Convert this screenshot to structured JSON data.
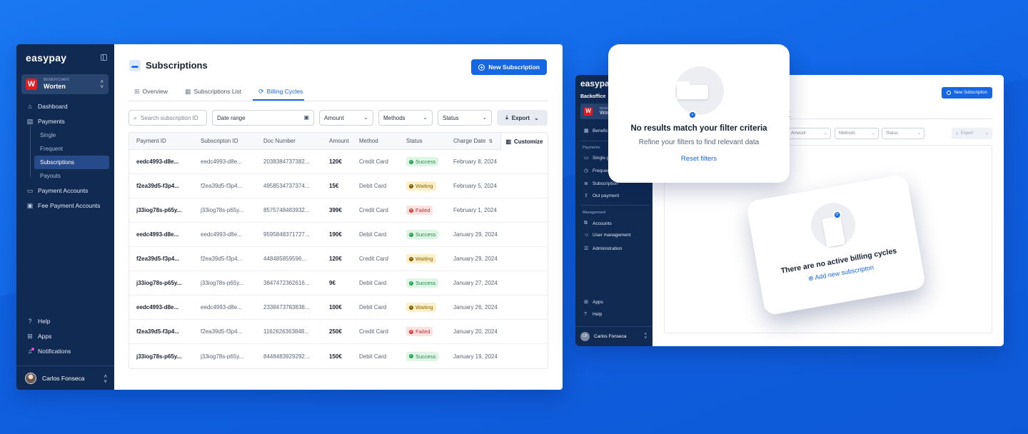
{
  "main_window": {
    "sidebar": {
      "logo": "easypay",
      "beneficiary": {
        "tag": "BENEFICIARY",
        "name": "Worten",
        "logo_letter": "W"
      },
      "nav": [
        {
          "label": "Dashboard"
        },
        {
          "label": "Payments"
        },
        {
          "label": "Single"
        },
        {
          "label": "Frequent"
        },
        {
          "label": "Subscriptions"
        },
        {
          "label": "Payouts"
        },
        {
          "label": "Payment Accounts"
        },
        {
          "label": "Fee Payment Accounts"
        }
      ],
      "bottom": [
        {
          "label": "Help"
        },
        {
          "label": "Apps"
        },
        {
          "label": "Notifications"
        }
      ],
      "user": "Carlos Fonseca"
    },
    "header": {
      "title": "Subscriptions",
      "new_button": "New Subscription"
    },
    "tabs": [
      {
        "label": "Overview"
      },
      {
        "label": "Subscriptions List"
      },
      {
        "label": "Billing Cycles"
      }
    ],
    "filters": {
      "search_placeholder": "Search subscription ID",
      "date_range": "Date range",
      "amount": "Amount",
      "methods": "Methods",
      "status": "Status",
      "export": "Export"
    },
    "table": {
      "columns": [
        "Payment ID",
        "Subscripton ID",
        "Doc Number",
        "Amount",
        "Method",
        "Status",
        "Charge Date"
      ],
      "customize": "Customize",
      "rows": [
        {
          "pid": "eedc4993-d8e...",
          "sid": "eedc4993-d8e...",
          "doc": "2038384737382...",
          "amt": "120€",
          "met": "Credit Card",
          "sta": "Success",
          "date": "February 8, 2024"
        },
        {
          "pid": "f2ea39d5-f3p4...",
          "sid": "f2ea39d5-f3p4...",
          "doc": "4958534737374...",
          "amt": "15€",
          "met": "Debit Card",
          "sta": "Waiting",
          "date": "February 5, 2024"
        },
        {
          "pid": "j33iog78s-p65y...",
          "sid": "j33iog78s-p65y...",
          "doc": "8575748483932...",
          "amt": "399€",
          "met": "Credit Card",
          "sta": "Failed",
          "date": "February 1, 2024"
        },
        {
          "pid": "eedc4993-d8e...",
          "sid": "eedc4993-d8e...",
          "doc": "9595848371727...",
          "amt": "190€",
          "met": "Debit Card",
          "sta": "Success",
          "date": "January 29, 2024"
        },
        {
          "pid": "f2ea39d5-f3p4...",
          "sid": "f2ea39d5-f3p4...",
          "doc": "448485859596...",
          "amt": "120€",
          "met": "Credit Card",
          "sta": "Waiting",
          "date": "January 29, 2024"
        },
        {
          "pid": "j33iog78s-p65y...",
          "sid": "j33iog78s-p65y...",
          "doc": "3847472362616...",
          "amt": "9€",
          "met": "Debit Card",
          "sta": "Success",
          "date": "January 27, 2024"
        },
        {
          "pid": "eedc4993-d8e...",
          "sid": "eedc4993-d8e...",
          "doc": "2338473783838...",
          "amt": "100€",
          "met": "Debit Card",
          "sta": "Waiting",
          "date": "January 26, 2024"
        },
        {
          "pid": "f2ea39d5-f3p4...",
          "sid": "f2ea39d5-f3p4...",
          "doc": "1162626363848...",
          "amt": "250€",
          "met": "Credit Card",
          "sta": "Failed",
          "date": "January 20, 2024"
        },
        {
          "pid": "j33iog78s-p65y...",
          "sid": "j33iog78s-p65y...",
          "doc": "8448483929292...",
          "amt": "150€",
          "met": "Debit Card",
          "sta": "Success",
          "date": "January 19, 2024"
        }
      ]
    }
  },
  "back_window": {
    "logo": "easypay",
    "backoffice": "Backoffice",
    "beneficiary": {
      "tag": "BENEFI",
      "name": "Wort",
      "logo_letter": "W"
    },
    "items": {
      "benef": "Benefici",
      "sec_payments": "Payments",
      "single": "Single p",
      "frequent": "Frequen",
      "subscription": "Subscription",
      "out_payment": "Out payment",
      "sec_management": "Management",
      "accounts": "Accounts",
      "user_management": "User management",
      "administration": "Administration",
      "apps": "Apps",
      "help": "Help"
    },
    "user": "Carlos Fonseca",
    "user_initials": "CF",
    "new_button": "New Subscription",
    "tab": "rcles",
    "filters": {
      "amount": "Amount",
      "methods": "Methods",
      "status": "Status",
      "export": "Export"
    }
  },
  "empty_filter_card": {
    "title": "No results match your filter criteria",
    "subtitle": "Refine your filters to find relevant data",
    "action": "Reset filters"
  },
  "empty_billing_card": {
    "title": "There are no active billing cycles",
    "action": "Add new subscripton"
  },
  "colors": {
    "accent": "#1767e3",
    "sidebar": "#102a52",
    "success": "#22a153",
    "waiting": "#7d5b00",
    "failed": "#d93b3b"
  }
}
